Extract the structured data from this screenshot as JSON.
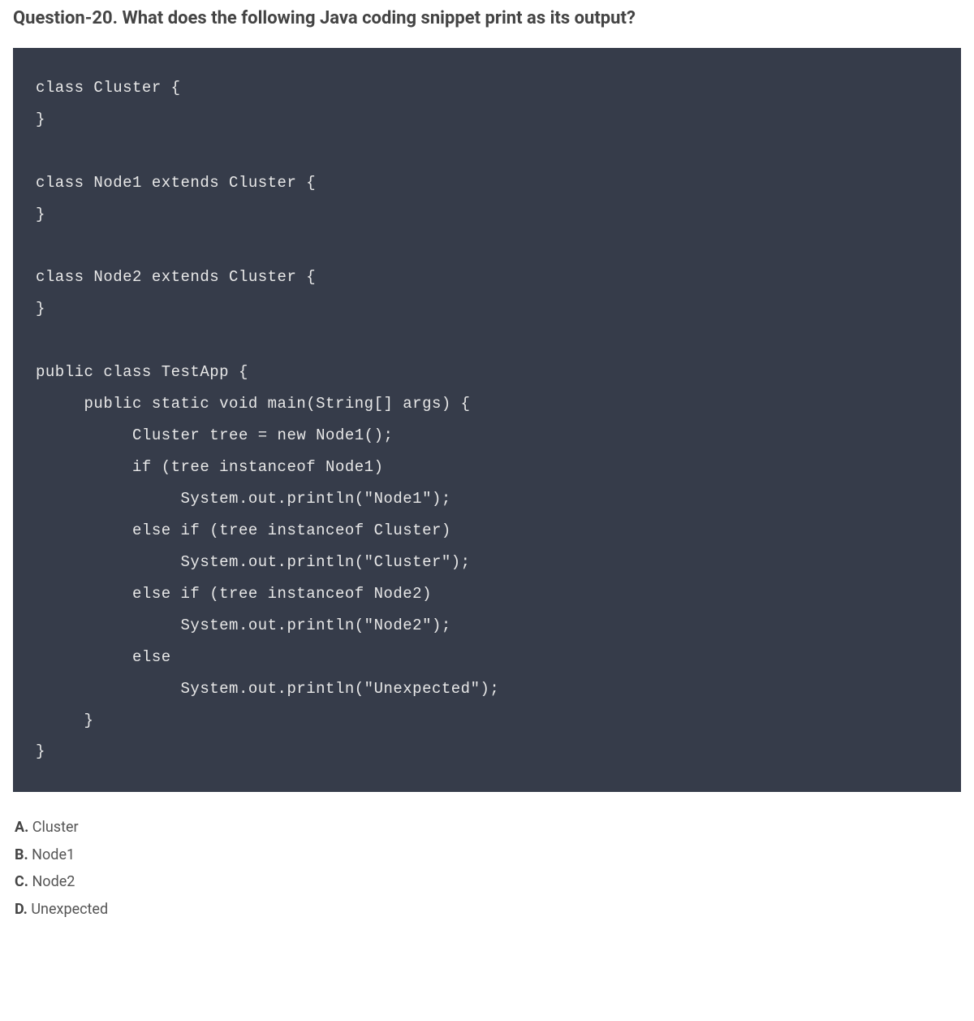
{
  "question": {
    "title": "Question-20. What does the following Java coding snippet print as its output?"
  },
  "code": {
    "lines": [
      "class Cluster {",
      "}",
      "",
      "class Node1 extends Cluster {",
      "}",
      "",
      "class Node2 extends Cluster {",
      "}",
      "",
      "public class TestApp {",
      "     public static void main(String[] args) {",
      "          Cluster tree = new Node1();",
      "          if (tree instanceof Node1)",
      "               System.out.println(\"Node1\");",
      "          else if (tree instanceof Cluster)",
      "               System.out.println(\"Cluster\");",
      "          else if (tree instanceof Node2)",
      "               System.out.println(\"Node2\");",
      "          else",
      "               System.out.println(\"Unexpected\");",
      "     }",
      "}"
    ]
  },
  "answers": [
    {
      "letter": "A.",
      "text": " Cluster"
    },
    {
      "letter": "B.",
      "text": " Node1"
    },
    {
      "letter": "C.",
      "text": " Node2"
    },
    {
      "letter": "D.",
      "text": " Unexpected"
    }
  ]
}
